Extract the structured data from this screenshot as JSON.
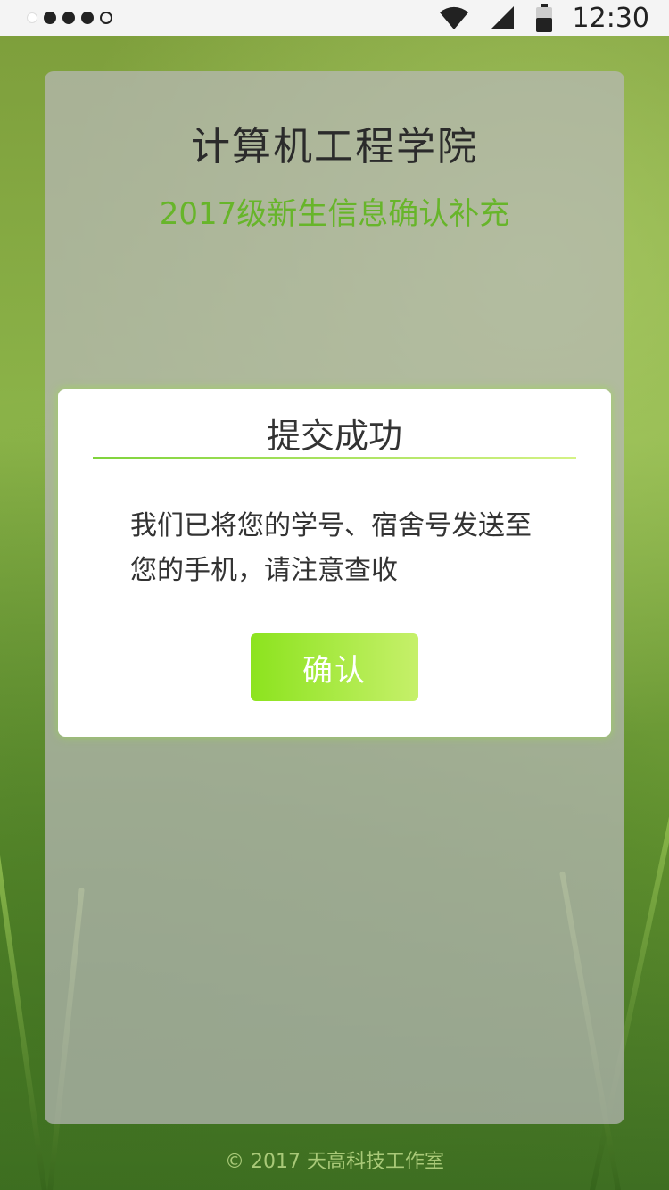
{
  "status_bar": {
    "time": "12:30",
    "signal_icon": "cell-signal-icon",
    "wifi_icon": "wifi-icon",
    "battery_icon": "battery-icon"
  },
  "header": {
    "college": "计算机工程学院",
    "subtitle": "2017级新生信息确认补充"
  },
  "dialog": {
    "title": "提交成功",
    "message": "我们已将您的学号、宿舍号发送至您的手机，请注意查收",
    "confirm_label": "确认"
  },
  "footer": {
    "copyright": "© 2017 天高科技工作室"
  },
  "colors": {
    "accent": "#67b52a",
    "button_start": "#8ce31e",
    "button_end": "#c6f06a"
  }
}
